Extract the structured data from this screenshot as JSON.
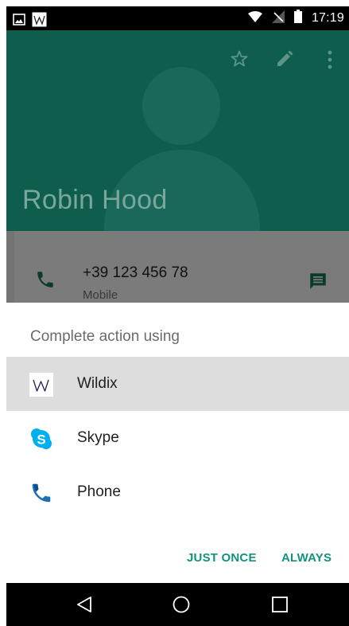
{
  "status_bar": {
    "time": "17:19",
    "left_icons": [
      "image-icon",
      "wildix-notification-icon"
    ],
    "right_icons": [
      "wifi-icon",
      "no-signal-icon",
      "battery-icon"
    ]
  },
  "contact": {
    "name": "Robin Hood",
    "actions": [
      "star-icon",
      "edit-icon",
      "more-vert-icon"
    ],
    "phone_number": "+39 123 456 78",
    "phone_type": "Mobile"
  },
  "dialog": {
    "title": "Complete action using",
    "options": [
      {
        "label": "Wildix",
        "icon": "wildix-icon",
        "selected": true
      },
      {
        "label": "Skype",
        "icon": "skype-icon",
        "selected": false
      },
      {
        "label": "Phone",
        "icon": "phone-app-icon",
        "selected": false
      }
    ],
    "buttons": {
      "just_once": "JUST ONCE",
      "always": "ALWAYS"
    }
  },
  "nav_bar": {
    "buttons": [
      "back-icon",
      "home-icon",
      "recents-icon"
    ]
  },
  "colors": {
    "header": "#0f5e4d",
    "accent": "#12927f",
    "selected_row": "#dddddd"
  }
}
